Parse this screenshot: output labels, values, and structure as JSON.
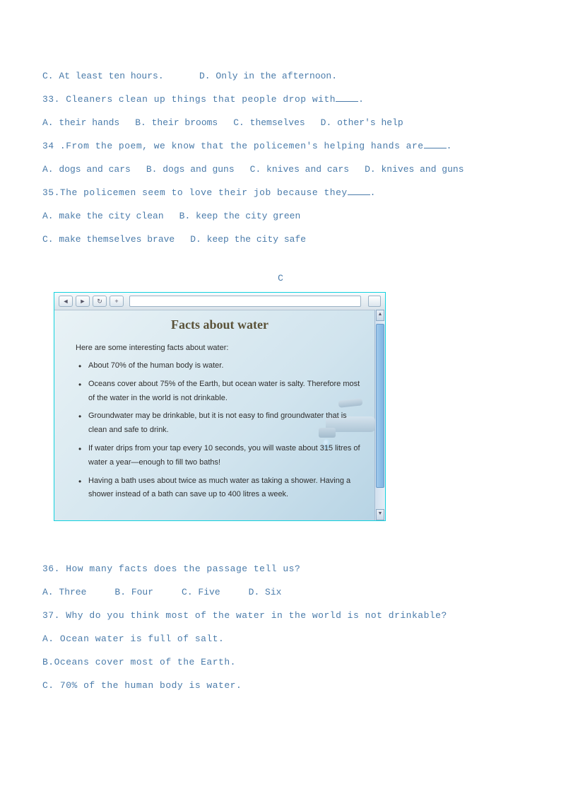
{
  "q32_opts": {
    "c": "C. At least ten hours.",
    "d": "D. Only in the afternoon."
  },
  "q33": {
    "stem_pre": "33. Cleaners clean up things that people drop with",
    "stem_post": ".",
    "a": "A. their hands",
    "b": "B. their brooms",
    "c": "C. themselves",
    "d": "D. other's help"
  },
  "q34": {
    "stem_pre": "34 .From the poem, we know that the policemen's helping hands are",
    "stem_post": ".",
    "a": "A. dogs and cars",
    "b": "B. dogs and guns",
    "c": "C. knives and cars",
    "d": "D. knives and guns"
  },
  "q35": {
    "stem_pre": "35.The policemen seem to love their job because they",
    "stem_post": ".",
    "a": "A. make the city clean",
    "b": "B. keep the city green",
    "c": "C. make themselves brave",
    "d": "D. keep the city safe"
  },
  "section_label": "C",
  "browser": {
    "nav_back": "◄",
    "nav_fwd": "►",
    "nav_refresh": "↻",
    "nav_plus": "+",
    "scroll_up": "▲",
    "scroll_down": "▼"
  },
  "passage": {
    "title": "Facts about water",
    "intro": "Here are some interesting facts about water:",
    "bullets": [
      "About 70% of the human body is water.",
      "Oceans cover about 75% of the Earth, but ocean water is salty. Therefore most of the water in the world is not drinkable.",
      "Groundwater may be drinkable, but it is not easy to find groundwater that is clean and safe to drink.",
      "If water drips from your tap every 10 seconds, you will waste about 315 litres of water a year—enough to fill two baths!",
      "Having a bath uses about twice as much water as taking a shower. Having a shower instead of a bath can save up to 400 litres a week."
    ]
  },
  "q36": {
    "stem": "36. How many facts does the passage tell us?",
    "a": "A. Three",
    "b": "B. Four",
    "c": "C. Five",
    "d": "D. Six"
  },
  "q37": {
    "stem": "37. Why do you think most of the water in the world is not drinkable?",
    "a": "A. Ocean water is full of salt.",
    "b": "B.Oceans cover most of the Earth.",
    "c": "C. 70% of the human body is water."
  }
}
